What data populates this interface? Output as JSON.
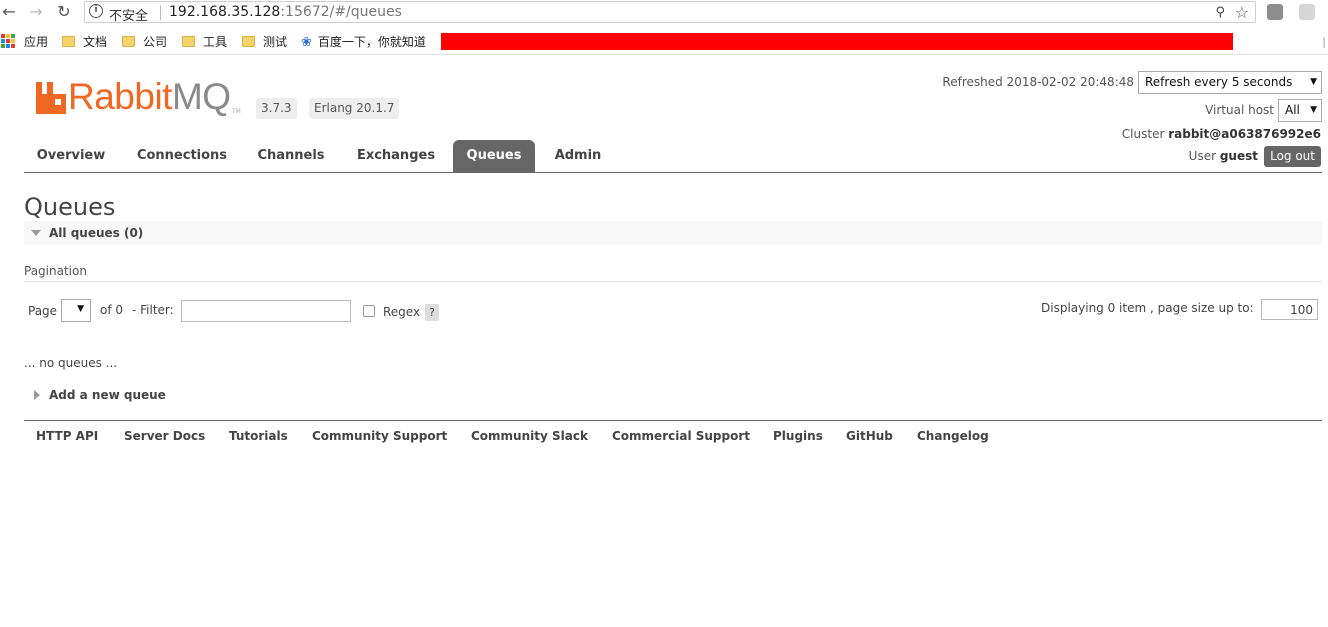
{
  "browser": {
    "insecure_label": "不安全",
    "url_host": "192.168.35.128",
    "url_rest": ":15672/#/queues",
    "bookmarks": [
      "应用",
      "文档",
      "公司",
      "工具",
      "测试",
      "百度一下，你就知道"
    ]
  },
  "header": {
    "product_name": "Rabbit",
    "product_suffix": "MQ",
    "trademark": "TM",
    "version": "3.7.3",
    "erlang": "Erlang 20.1.7",
    "refreshed_label": "Refreshed 2018-02-02 20:48:48",
    "refresh_select": "Refresh every 5 seconds",
    "vhost_label": "Virtual host",
    "vhost_select": "All",
    "cluster_label": "Cluster",
    "cluster_name": "rabbit@a063876992e6",
    "user_label": "User",
    "user_name": "guest",
    "logout_label": "Log out"
  },
  "tabs": [
    "Overview",
    "Connections",
    "Channels",
    "Exchanges",
    "Queues",
    "Admin"
  ],
  "active_tab": "Queues",
  "main": {
    "title": "Queues",
    "section_title": "All queues (0)",
    "pagination_label": "Pagination",
    "page_label": "Page",
    "of_label": "of 0",
    "filter_label": "- Filter:",
    "regex_label": "Regex",
    "help_label": "?",
    "displaying_label": "Displaying 0 item , page size up to:",
    "page_size": "100",
    "empty_text": "... no queues ...",
    "add_queue_label": "Add a new queue"
  },
  "footer": {
    "links": [
      "HTTP API",
      "Server Docs",
      "Tutorials",
      "Community Support",
      "Community Slack",
      "Commercial Support",
      "Plugins",
      "GitHub",
      "Changelog"
    ]
  },
  "colors": {
    "brand_orange": "#f26722",
    "brand_gray": "#8a8a8a",
    "tab_active": "#666666",
    "redaction": "#ff0000"
  }
}
